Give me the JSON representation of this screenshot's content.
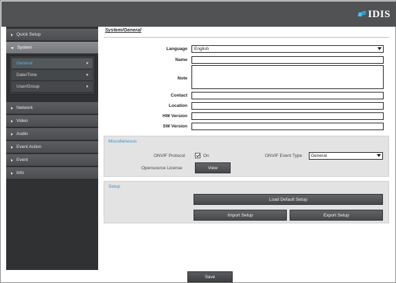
{
  "brand": {
    "logo_text": "IDIS"
  },
  "sidebar": {
    "items": [
      {
        "label": "Quick Setup"
      },
      {
        "label": "System"
      },
      {
        "label": "Network"
      },
      {
        "label": "Video"
      },
      {
        "label": "Audio"
      },
      {
        "label": "Event Action"
      },
      {
        "label": "Event"
      },
      {
        "label": "Info"
      }
    ],
    "submenu": [
      {
        "label": "General"
      },
      {
        "label": "Date/Time"
      },
      {
        "label": "User/Group"
      }
    ]
  },
  "main": {
    "title": "System/General",
    "fields": {
      "language_label": "Language",
      "language_value": "English",
      "name_label": "Name",
      "note_label": "Note",
      "contact_label": "Contact",
      "location_label": "Location",
      "hw_version_label": "HW Version",
      "sw_version_label": "SW Version",
      "name_value": "",
      "contact_value": "",
      "location_value": "",
      "hw_version_value": "",
      "sw_version_value": ""
    },
    "misc": {
      "title": "Miscellaneous",
      "onvif_protocol_label": "ONVIF Protocol",
      "onvif_checkbox_label": "On",
      "onvif_event_type_label": "ONVIF Event Type",
      "onvif_event_type_value": "General",
      "opensource_label": "Opensource License",
      "view_button": "View"
    },
    "setup": {
      "title": "Setup",
      "load_default_button": "Load Default Setup",
      "import_button": "Import Setup",
      "export_button": "Export Setup"
    },
    "save_button": "Save"
  }
}
